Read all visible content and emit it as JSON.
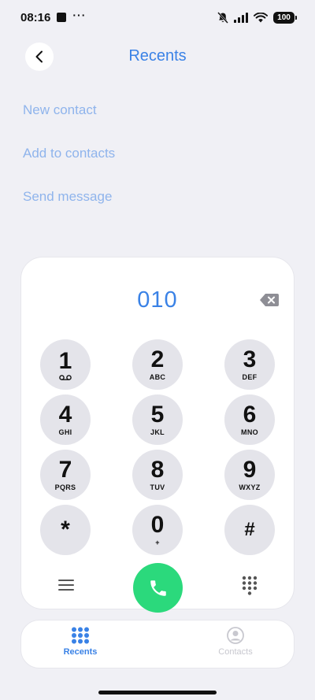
{
  "status_bar": {
    "time": "08:16",
    "dots": "···",
    "battery": "100",
    "icons": [
      "notification-square-icon",
      "mute-bell-icon",
      "signal-icon",
      "wifi-icon",
      "battery-icon"
    ]
  },
  "header": {
    "title": "Recents",
    "back_icon": "chevron-left-icon"
  },
  "actions": [
    {
      "label": "New contact"
    },
    {
      "label": "Add to contacts"
    },
    {
      "label": "Send message"
    }
  ],
  "dialer": {
    "number": "010",
    "keys": [
      {
        "digit": "1",
        "sub": ""
      },
      {
        "digit": "2",
        "sub": "ABC"
      },
      {
        "digit": "3",
        "sub": "DEF"
      },
      {
        "digit": "4",
        "sub": "GHI"
      },
      {
        "digit": "5",
        "sub": "JKL"
      },
      {
        "digit": "6",
        "sub": "MNO"
      },
      {
        "digit": "7",
        "sub": "PQRS"
      },
      {
        "digit": "8",
        "sub": "TUV"
      },
      {
        "digit": "9",
        "sub": "WXYZ"
      },
      {
        "digit": "*",
        "sub": ""
      },
      {
        "digit": "0",
        "sub": "+"
      },
      {
        "digit": "#",
        "sub": ""
      }
    ]
  },
  "tabs": {
    "recents": "Recents",
    "contacts": "Contacts"
  },
  "colors": {
    "accent": "#3a82e6",
    "action_text": "#8fb4ec",
    "call_green": "#2bd97c",
    "key_bg": "#e4e4ea",
    "background": "#f0f0f5"
  }
}
